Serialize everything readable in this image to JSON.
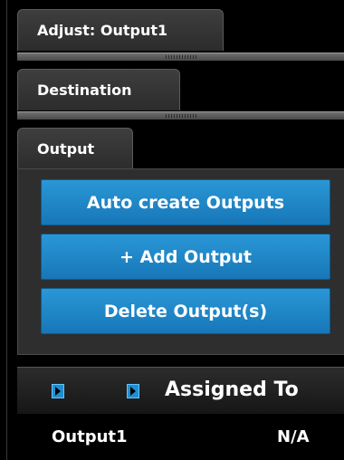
{
  "tabs": {
    "adjust": "Adjust: Output1",
    "destination": "Destination",
    "output": "Output"
  },
  "buttons": {
    "auto_create": "Auto create Outputs",
    "add_output": "+ Add Output",
    "delete_outputs": "Delete Output(s)"
  },
  "grid": {
    "header_assigned": "Assigned To",
    "rows": [
      {
        "name": "Output1",
        "assigned": "N/A"
      }
    ]
  },
  "colors": {
    "button_blue": "#1f87c7",
    "accent_icon": "#1f8fcf"
  }
}
